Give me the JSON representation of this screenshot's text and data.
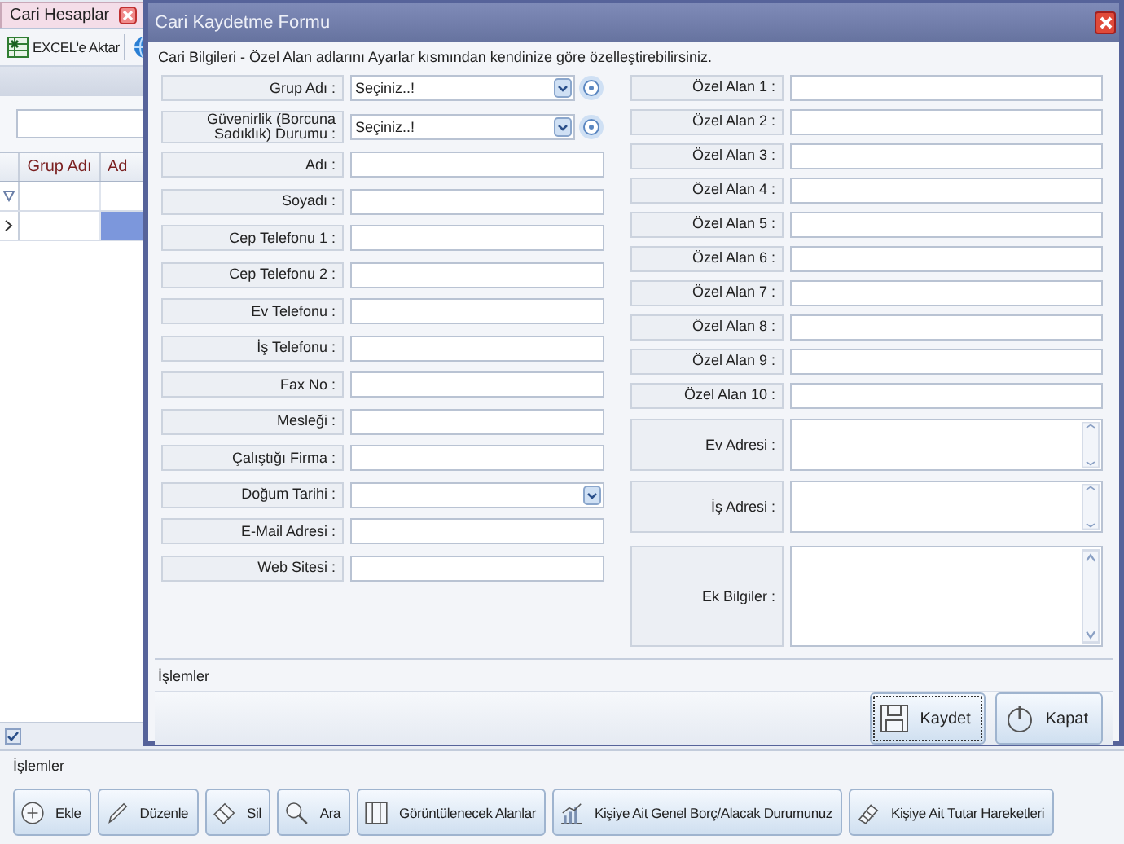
{
  "app": {
    "tab": {
      "label": "Cari Hesaplar"
    },
    "toolbar": [
      {
        "label": "EXCEL'e Aktar"
      }
    ],
    "grid": {
      "columns": [
        "Grup Adı",
        "Ad"
      ],
      "rows": [
        {
          "selected": true
        }
      ]
    },
    "section_label": "İşlemler",
    "actions": [
      {
        "label": "Ekle"
      },
      {
        "label": "Düzenle"
      },
      {
        "label": "Sil"
      },
      {
        "label": "Ara"
      },
      {
        "label": "Görüntülenecek Alanlar"
      },
      {
        "label": "Kişiye Ait Genel Borç/Alacak Durumunuz"
      },
      {
        "label": "Kişiye Ait Tutar Hareketleri"
      }
    ]
  },
  "dialog": {
    "title": "Cari Kaydetme Formu",
    "info": "Cari Bilgileri - Özel Alan adlarını Ayarlar kısmından kendinize göre özelleştirebilirsiniz.",
    "left_fields": [
      {
        "label": "Grup Adı :",
        "kind": "combo",
        "value": "Seçiniz..!"
      },
      {
        "label": "Güvenirlik (Borcuna Sadıklık) Durumu :",
        "kind": "combo",
        "value": "Seçiniz..!"
      },
      {
        "label": "Adı :",
        "kind": "text"
      },
      {
        "label": "Soyadı :",
        "kind": "text"
      },
      {
        "label": "Cep Telefonu 1 :",
        "kind": "text"
      },
      {
        "label": "Cep Telefonu 2 :",
        "kind": "text"
      },
      {
        "label": "Ev Telefonu :",
        "kind": "text"
      },
      {
        "label": "İş Telefonu :",
        "kind": "text"
      },
      {
        "label": "Fax No :",
        "kind": "text"
      },
      {
        "label": "Mesleği :",
        "kind": "text"
      },
      {
        "label": "Çalıştığı Firma :",
        "kind": "text"
      },
      {
        "label": "Doğum Tarihi :",
        "kind": "date"
      },
      {
        "label": "E-Mail Adresi :",
        "kind": "text"
      },
      {
        "label": "Web Sitesi :",
        "kind": "text"
      }
    ],
    "right_fields": [
      {
        "label": "Özel Alan 1 :",
        "kind": "text"
      },
      {
        "label": "Özel Alan 2 :",
        "kind": "text"
      },
      {
        "label": "Özel Alan 3 :",
        "kind": "text"
      },
      {
        "label": "Özel Alan 4 :",
        "kind": "text"
      },
      {
        "label": "Özel Alan 5 :",
        "kind": "text"
      },
      {
        "label": "Özel Alan 6 :",
        "kind": "text"
      },
      {
        "label": "Özel Alan 7 :",
        "kind": "text"
      },
      {
        "label": "Özel Alan 8 :",
        "kind": "text"
      },
      {
        "label": "Özel Alan 9 :",
        "kind": "text"
      },
      {
        "label": "Özel Alan 10 :",
        "kind": "text"
      },
      {
        "label": "Ev Adresi :",
        "kind": "memo"
      },
      {
        "label": "İş Adresi :",
        "kind": "memo"
      },
      {
        "label": "Ek Bilgiler :",
        "kind": "memo"
      }
    ],
    "section_label": "İşlemler",
    "buttons": [
      {
        "label": "Kaydet",
        "focused": true
      },
      {
        "label": "Kapat",
        "focused": false
      }
    ]
  }
}
